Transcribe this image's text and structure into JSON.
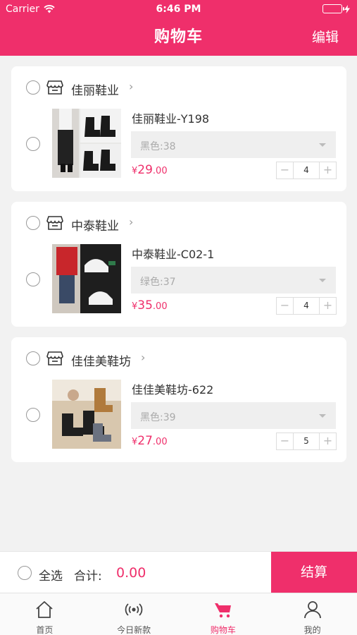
{
  "status_bar": {
    "carrier": "Carrier",
    "time": "6:46 PM"
  },
  "nav": {
    "title": "购物车",
    "edit_label": "编辑"
  },
  "stores": [
    {
      "name": "佳丽鞋业",
      "chevron": "›",
      "product_title": "佳丽鞋业-Y198",
      "sku": "黑色:38",
      "currency": "¥",
      "price_int": "29",
      "price_dec": ".00",
      "qty": "4"
    },
    {
      "name": "中泰鞋业",
      "chevron": "›",
      "product_title": "中泰鞋业-C02-1",
      "sku": "绿色:37",
      "currency": "¥",
      "price_int": "35",
      "price_dec": ".00",
      "qty": "4"
    },
    {
      "name": "佳佳美鞋坊",
      "chevron": "›",
      "product_title": "佳佳美鞋坊-622",
      "sku": "黑色:39",
      "currency": "¥",
      "price_int": "27",
      "price_dec": ".00",
      "qty": "5"
    }
  ],
  "stepper": {
    "minus": "−",
    "plus": "+"
  },
  "checkout": {
    "select_all": "全选",
    "total_label": "合计:",
    "total_value": "0.00",
    "button": "结算"
  },
  "tabs": [
    {
      "label": "首页",
      "icon": "home-icon",
      "active": false
    },
    {
      "label": "今日新款",
      "icon": "broadcast-icon",
      "active": false
    },
    {
      "label": "购物车",
      "icon": "cart-icon",
      "active": true
    },
    {
      "label": "我的",
      "icon": "user-icon",
      "active": false
    }
  ],
  "colors": {
    "accent": "#ef2f6b",
    "background": "#f2f2f2"
  }
}
